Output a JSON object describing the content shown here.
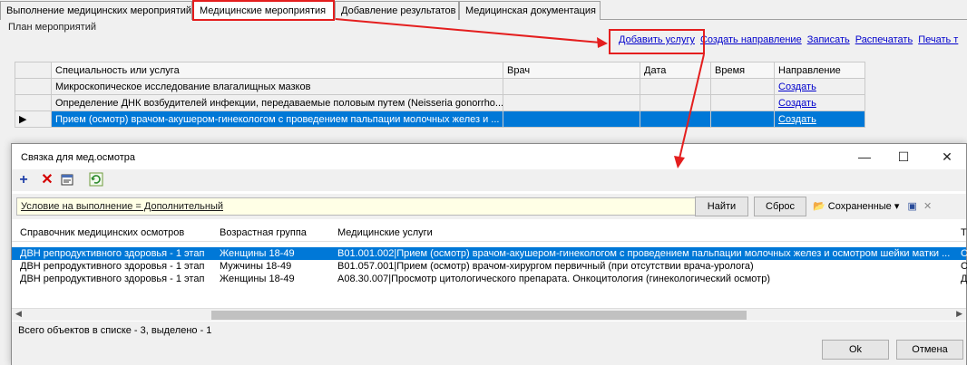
{
  "tabs": [
    {
      "label": "Выполнение медицинских мероприятий",
      "active": false
    },
    {
      "label": "Медицинские мероприятия",
      "active": true
    },
    {
      "label": "Добавление результатов",
      "active": false
    },
    {
      "label": "Медицинская документация",
      "active": false
    }
  ],
  "plan": {
    "label": "План мероприятий",
    "links": [
      "Добавить услугу",
      "Создать направление",
      "Записать",
      "Распечатать",
      "Печать т"
    ],
    "columns": [
      "Специальность или услуга",
      "Врач",
      "Дата",
      "Время",
      "Направление"
    ],
    "rows": [
      {
        "service": "Микроскопическое исследование влагалищных мазков",
        "doctor": "",
        "date": "",
        "time": "",
        "direction": "Создать",
        "selected": false
      },
      {
        "service": "Определение ДНК возбудителей инфекции, передаваемые половым путем (Neisseria gonorrho...",
        "doctor": "",
        "date": "",
        "time": "",
        "direction": "Создать",
        "selected": false
      },
      {
        "service": "Прием (осмотр) врачом-акушером-гинекологом с проведением пальпации молочных желез и ...",
        "doctor": "",
        "date": "",
        "time": "",
        "direction": "Создать",
        "selected": true
      }
    ]
  },
  "dialog": {
    "title": "Связка для мед.осмотра",
    "window_controls": {
      "minimize": "—",
      "maximize": "☐",
      "close": "✕"
    },
    "filter_text": "Условие на выполнение = Дополнительный",
    "find_button": "Найти",
    "reset_button": "Сброс",
    "saved_label": "Сохраненные",
    "columns": [
      "Справочник медицинских осмотров",
      "Возрастная группа",
      "Медицинские услуги",
      "Т"
    ],
    "rows": [
      {
        "ref": "ДВН репродуктивного здоровья - 1 этап",
        "age": "Женщины 18-49",
        "service": "B01.001.002|Прием (осмотр) врачом-акушером-гинекологом с проведением пальпации молочных желез и осмотром шейки матки ...",
        "extra": "С",
        "selected": true
      },
      {
        "ref": "ДВН репродуктивного здоровья - 1 этап",
        "age": "Мужчины 18-49",
        "service": "B01.057.001|Прием (осмотр) врачом-хирургом первичный (при отсутствии врача-уролога)",
        "extra": "С",
        "selected": false
      },
      {
        "ref": "ДВН репродуктивного здоровья - 1 этап",
        "age": "Женщины 18-49",
        "service": "A08.30.007|Просмотр цитологического препарата. Онкоцитология (гинекологический осмотр)",
        "extra": "Д",
        "selected": false
      }
    ],
    "status": "Всего объектов в списке - 3, выделено - 1",
    "ok_button": "Ok",
    "cancel_button": "Отмена"
  },
  "colors": {
    "selection": "#0078d7",
    "annotation": "#e41e1e",
    "link": "#0000cc"
  }
}
